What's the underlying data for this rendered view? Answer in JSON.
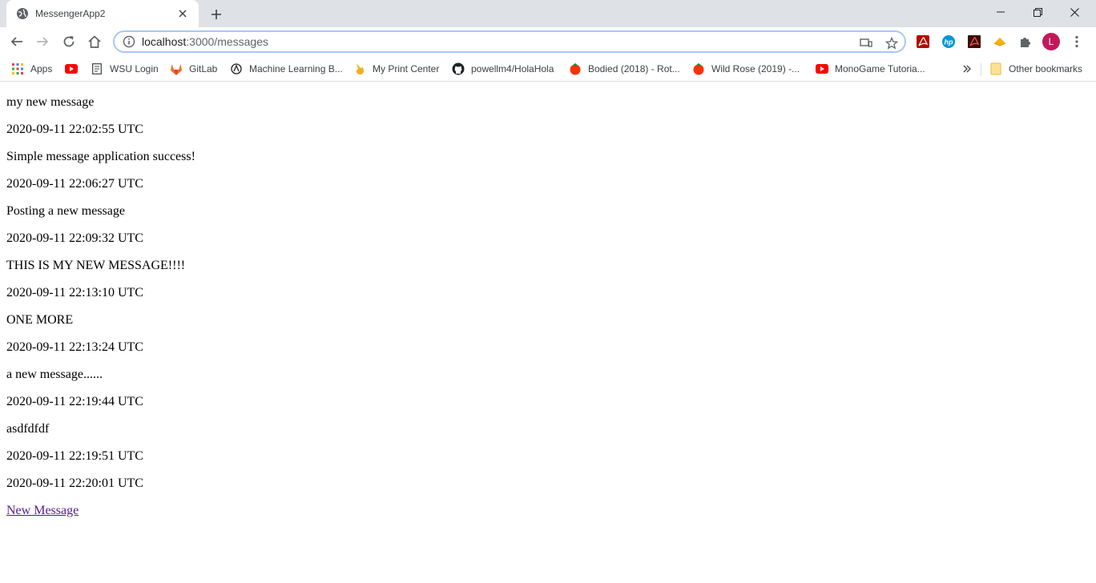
{
  "browser": {
    "tab_title": "MessengerApp2",
    "url_host": "localhost",
    "url_path": ":3000/messages",
    "profile_initial": "L"
  },
  "bookmarks": [
    {
      "label": "Apps",
      "icon": "apps-grid-icon"
    },
    {
      "label": "",
      "icon": "youtube-icon"
    },
    {
      "label": "WSU Login",
      "icon": "page-icon"
    },
    {
      "label": "GitLab",
      "icon": "gitlab-icon"
    },
    {
      "label": "Machine Learning B...",
      "icon": "ml-icon"
    },
    {
      "label": "My Print Center",
      "icon": "hand-icon"
    },
    {
      "label": "powellm4/HolaHola",
      "icon": "github-icon"
    },
    {
      "label": "Bodied (2018) - Rot...",
      "icon": "tomato-icon"
    },
    {
      "label": "Wild Rose (2019) -...",
      "icon": "tomato-icon"
    },
    {
      "label": "MonoGame Tutoria...",
      "icon": "youtube-icon"
    },
    {
      "label": "Other bookmarks",
      "icon": "folder-icon"
    }
  ],
  "messages": [
    {
      "text": "my new message",
      "time": "2020-09-11 22:02:55 UTC"
    },
    {
      "text": "Simple message application success!",
      "time": "2020-09-11 22:06:27 UTC"
    },
    {
      "text": "Posting a new message",
      "time": "2020-09-11 22:09:32 UTC"
    },
    {
      "text": "THIS IS MY NEW MESSAGE!!!!",
      "time": "2020-09-11 22:13:10 UTC"
    },
    {
      "text": "ONE MORE",
      "time": "2020-09-11 22:13:24 UTC"
    },
    {
      "text": "a new message......",
      "time": "2020-09-11 22:19:44 UTC"
    },
    {
      "text": "asdfdfdf",
      "time": "2020-09-11 22:19:51 UTC"
    },
    {
      "text": "",
      "time": "2020-09-11 22:20:01 UTC"
    }
  ],
  "new_message_link": "New Message",
  "colors": {
    "tabstrip": "#dee1e6",
    "omnibox_border": "#a8c7fa",
    "link_visited": "#551a8b",
    "avatar": "#c2185b"
  }
}
